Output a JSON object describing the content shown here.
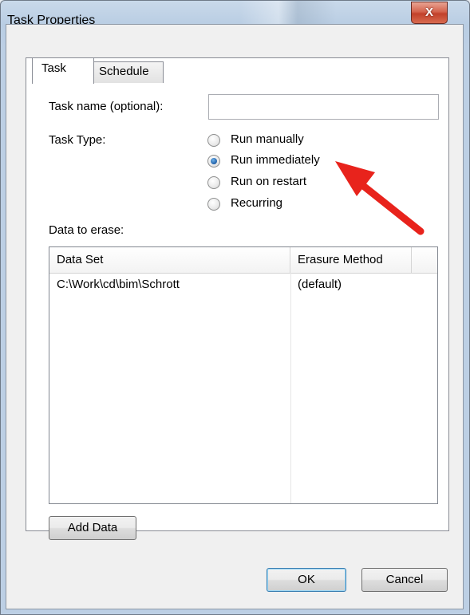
{
  "window": {
    "title": "Task Properties",
    "close_label": "X"
  },
  "tabs": [
    {
      "label": "Task",
      "active": true
    },
    {
      "label": "Schedule",
      "active": false
    }
  ],
  "form": {
    "task_name_label": "Task name (optional):",
    "task_name_value": "",
    "task_type_label": "Task Type:",
    "task_type_options": [
      {
        "label": "Run manually",
        "checked": false
      },
      {
        "label": "Run immediately",
        "checked": true
      },
      {
        "label": "Run on restart",
        "checked": false
      },
      {
        "label": "Recurring",
        "checked": false
      }
    ],
    "data_to_erase_label": "Data to erase:"
  },
  "list": {
    "columns": [
      "Data Set",
      "Erasure Method"
    ],
    "rows": [
      {
        "data_set": "C:\\Work\\cd\\bim\\Schrott",
        "erasure_method": "(default)"
      }
    ]
  },
  "buttons": {
    "add_data": "Add Data",
    "ok": "OK",
    "cancel": "Cancel"
  },
  "annotation": {
    "arrow_color": "#e8231c"
  }
}
